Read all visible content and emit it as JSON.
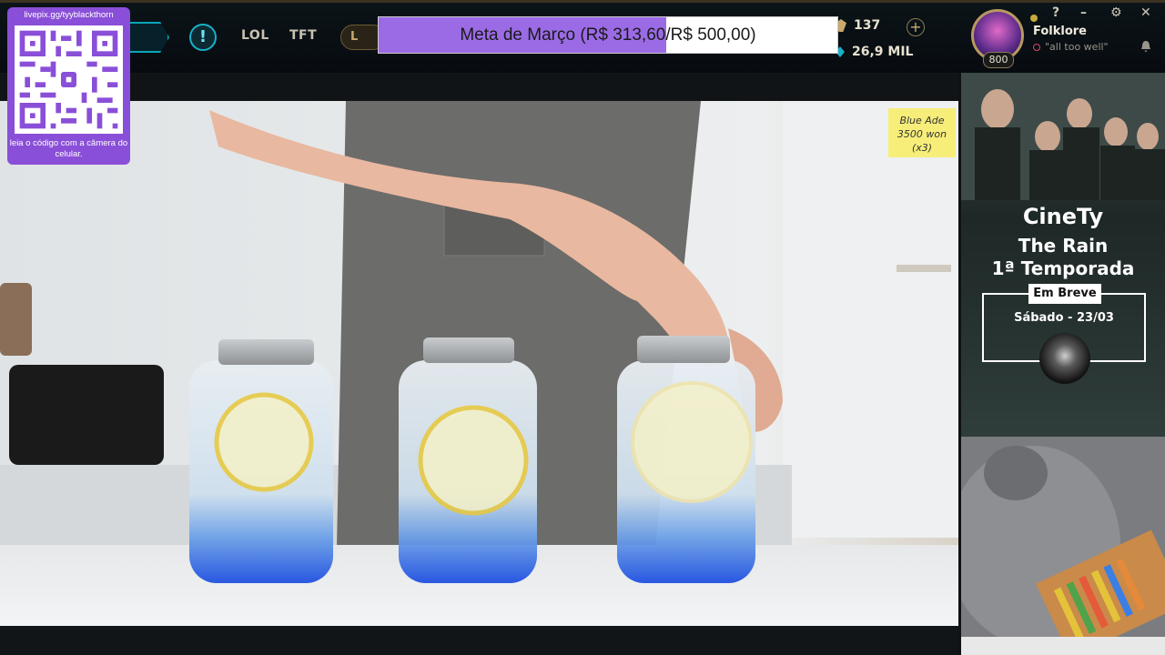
{
  "topbar": {
    "nav_lol": "LOL",
    "nav_tft": "TFT",
    "lol_badge": "L",
    "rp": "137",
    "blue_essence": "26,9 MIL",
    "level": "800",
    "username": "Folklore",
    "status_message": "\"all too well\"",
    "window_controls": {
      "help": "?",
      "minimize": "–",
      "settings": "⚙",
      "close": "✕"
    }
  },
  "goal": {
    "text": "Meta de Março (R$ 313,60/R$ 500,00)",
    "progress": 0.627
  },
  "qr": {
    "url": "livepix.gg/tyyblackthorn",
    "caption": "leia o código com a câmera do celular."
  },
  "video": {
    "sticky_note": [
      "Blue Ade",
      "3500 won",
      "(x3)"
    ]
  },
  "ad": {
    "brand": "CineTy",
    "show": "The Rain",
    "season": "1ª Temporada",
    "badge": "Em Breve",
    "date": "Sábado - 23/03"
  },
  "colors": {
    "goal_fill": "#9b6be6",
    "qr_bg": "#8a4fd8",
    "accent_teal": "#1ab0c8",
    "gold": "#c8aa6e"
  }
}
